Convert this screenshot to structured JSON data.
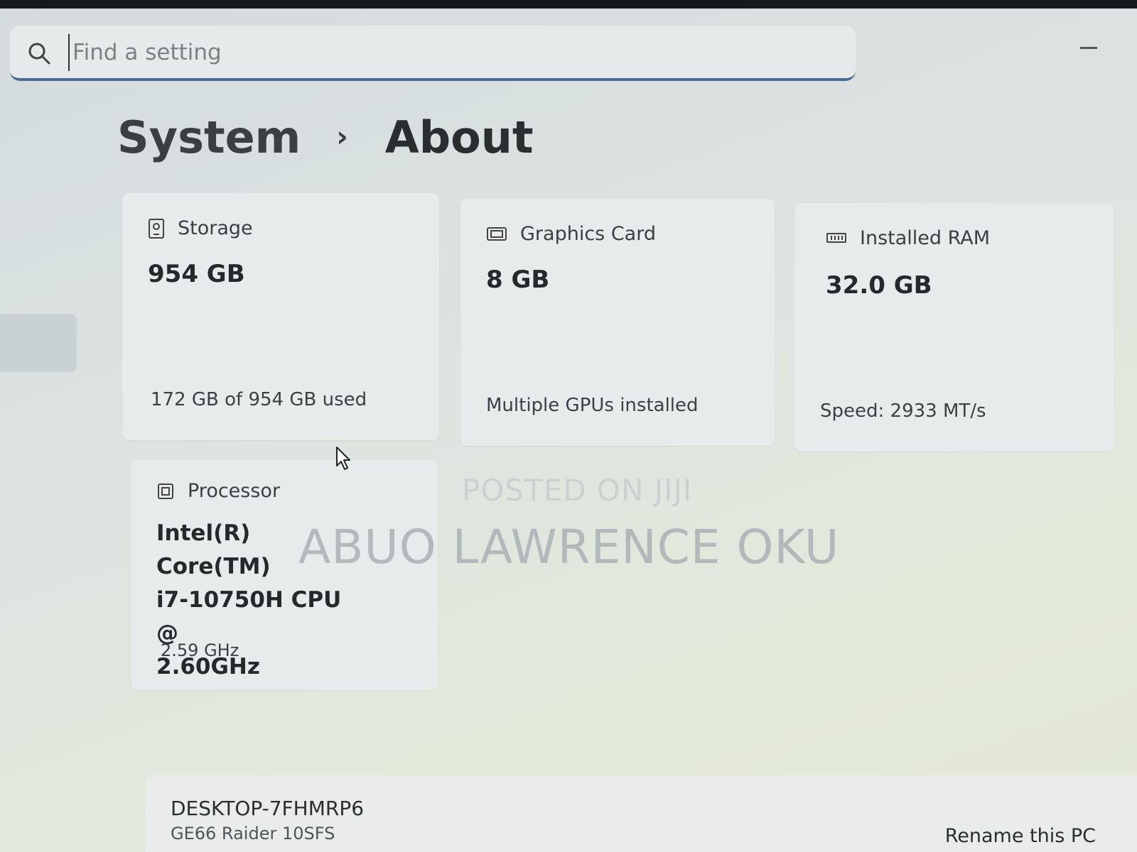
{
  "search": {
    "placeholder": "Find a setting"
  },
  "breadcrumb": {
    "parent": "System",
    "separator": "›",
    "current": "About"
  },
  "specs": {
    "storage": {
      "label": "Storage",
      "value": "954 GB",
      "detail": "172 GB of 954 GB used",
      "icon": "storage-icon"
    },
    "graphics": {
      "label": "Graphics Card",
      "value": "8 GB",
      "detail": "Multiple GPUs installed",
      "icon": "gpu-icon"
    },
    "ram": {
      "label": "Installed RAM",
      "value": "32.0 GB",
      "detail": "Speed: 2933 MT/s",
      "icon": "ram-icon"
    },
    "processor": {
      "label": "Processor",
      "value_lines": [
        "Intel(R) Core(TM)",
        "i7-10750H CPU @",
        "2.60GHz"
      ],
      "detail": "2.59 GHz",
      "icon": "processor-icon"
    }
  },
  "watermark": {
    "line1": "POSTED ON JIJI",
    "line2": "ABUO LAWRENCE OKU"
  },
  "device": {
    "name": "DESKTOP-7FHMRP6",
    "model": "GE66 Raider 10SFS",
    "rename_label": "Rename this PC"
  },
  "colors": {
    "search_underline": "#4a6b94",
    "card_bg": "#e8ebec"
  }
}
